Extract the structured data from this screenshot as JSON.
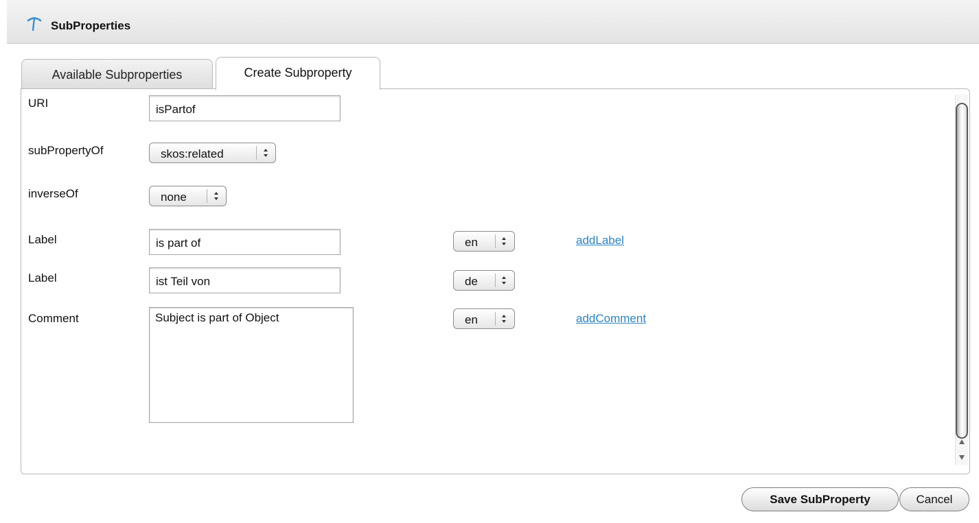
{
  "window": {
    "title": "SubProperties",
    "icon": "pickaxe-icon"
  },
  "tabs": [
    {
      "label": "Available Subproperties",
      "active": false
    },
    {
      "label": "Create Subproperty",
      "active": true
    }
  ],
  "form": {
    "uri": {
      "label": "URI",
      "value": "isPartof"
    },
    "subPropertyOf": {
      "label": "subPropertyOf",
      "value": "skos:related"
    },
    "inverseOf": {
      "label": "inverseOf",
      "value": "none"
    },
    "labels": [
      {
        "label": "Label",
        "value": "is part of",
        "lang": "en"
      },
      {
        "label": "Label",
        "value": "ist Teil von",
        "lang": "de"
      }
    ],
    "comment": {
      "label": "Comment",
      "value": "Subject is part of Object",
      "lang": "en"
    },
    "add_label_link": "addLabel",
    "add_comment_link": "addComment"
  },
  "buttons": {
    "save": "Save SubProperty",
    "cancel": "Cancel"
  },
  "colors": {
    "link": "#2b83c2",
    "title_icon": "#3a8fd0"
  }
}
